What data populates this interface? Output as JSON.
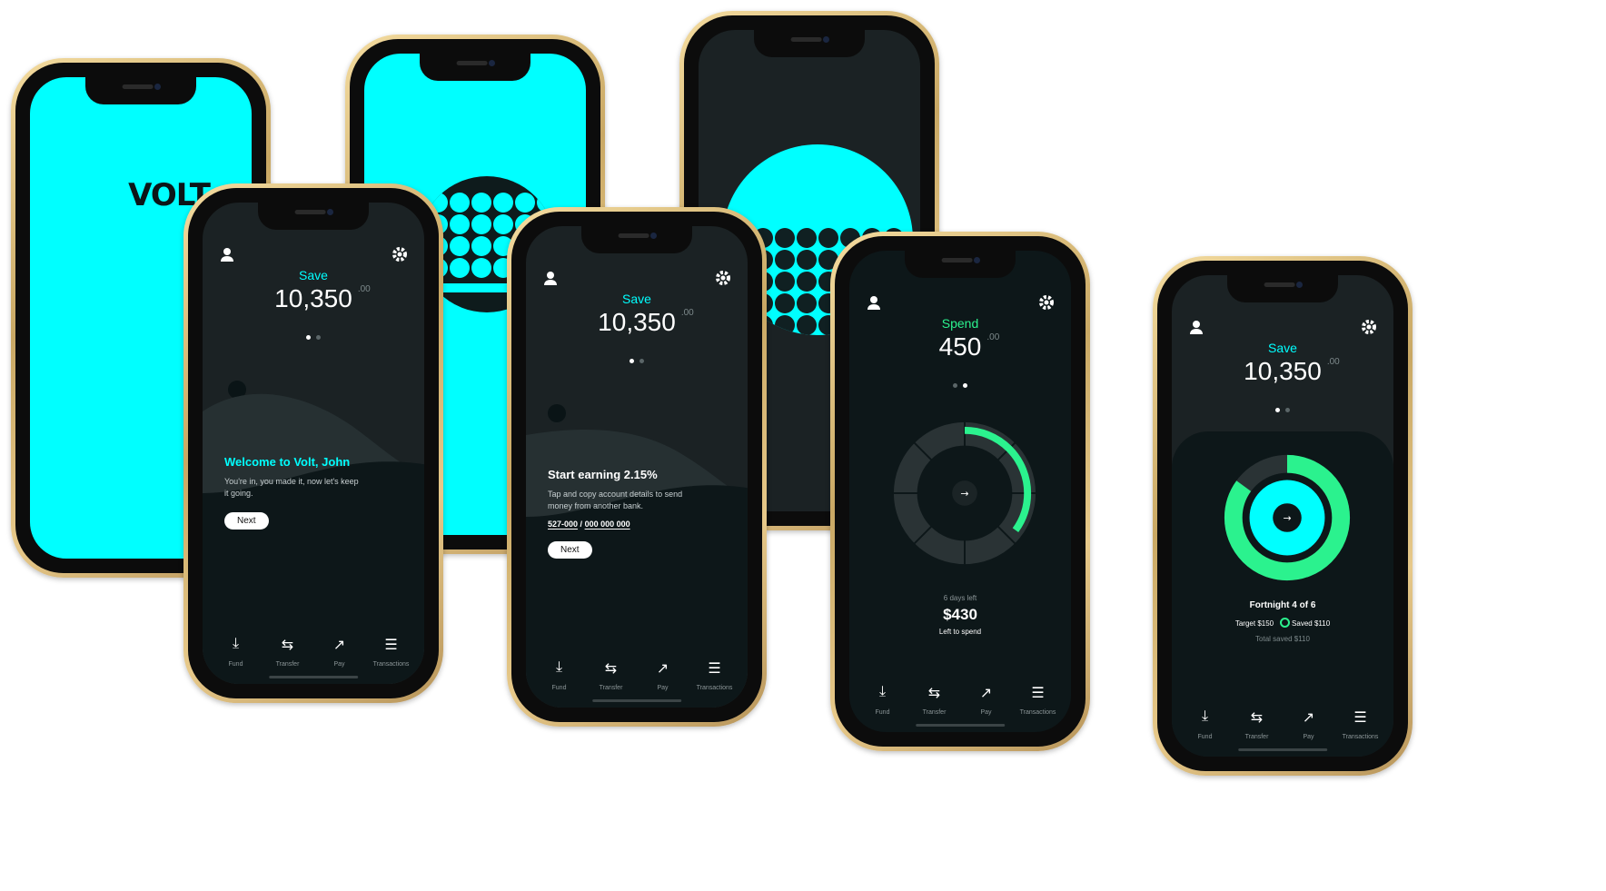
{
  "brand": {
    "logo": "VOLT"
  },
  "tabs": [
    "Fund",
    "Transfer",
    "Pay",
    "Transactions"
  ],
  "tab_icons": [
    "fund-icon",
    "transfer-icon",
    "pay-icon",
    "transactions-icon"
  ],
  "colors": {
    "cyan": "#00ffff",
    "green": "#2bf28e",
    "dark": "#1b2224",
    "gold": "#d8b878"
  },
  "save_welcome": {
    "label": "Save",
    "amount": "10,350",
    "cents": ".00",
    "title": "Welcome to Volt,  John",
    "body": "You're in, you made it, now let's keep it going.",
    "button": "Next"
  },
  "save_earning": {
    "label": "Save",
    "amount": "10,350",
    "cents": ".00",
    "title": "Start earning 2.15%",
    "body": "Tap and copy account details to send money from another bank.",
    "bsb": "527-000",
    "sep": "/",
    "account": "000 000 000",
    "button": "Next"
  },
  "spend": {
    "label": "Spend",
    "amount": "450",
    "cents": ".00",
    "days_left": "6 days left",
    "left_amount": "$430",
    "left_label": "Left to spend",
    "progress": 0.35
  },
  "save_progress": {
    "label": "Save",
    "amount": "10,350",
    "cents": ".00",
    "fortnight": "Fortnight 4 of 6",
    "target": "Target $150",
    "saved": "Saved $110",
    "total": "Total saved $110"
  }
}
